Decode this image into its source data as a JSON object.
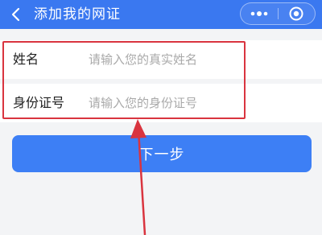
{
  "header": {
    "title": "添加我的网证",
    "back_icon": "chevron-left-icon",
    "more_icon": "more-dots-icon",
    "close_icon": "target-circle-icon",
    "bg_color": "#3a78f0"
  },
  "form": {
    "fields": [
      {
        "label": "姓名",
        "placeholder": "请输入您的真实姓名",
        "value": ""
      },
      {
        "label": "身份证号",
        "placeholder": "请输入您的身份证号",
        "value": ""
      }
    ]
  },
  "next_button": {
    "label": "下一步",
    "color": "#3d7ff5"
  },
  "annotation": {
    "color": "#d9343f"
  }
}
